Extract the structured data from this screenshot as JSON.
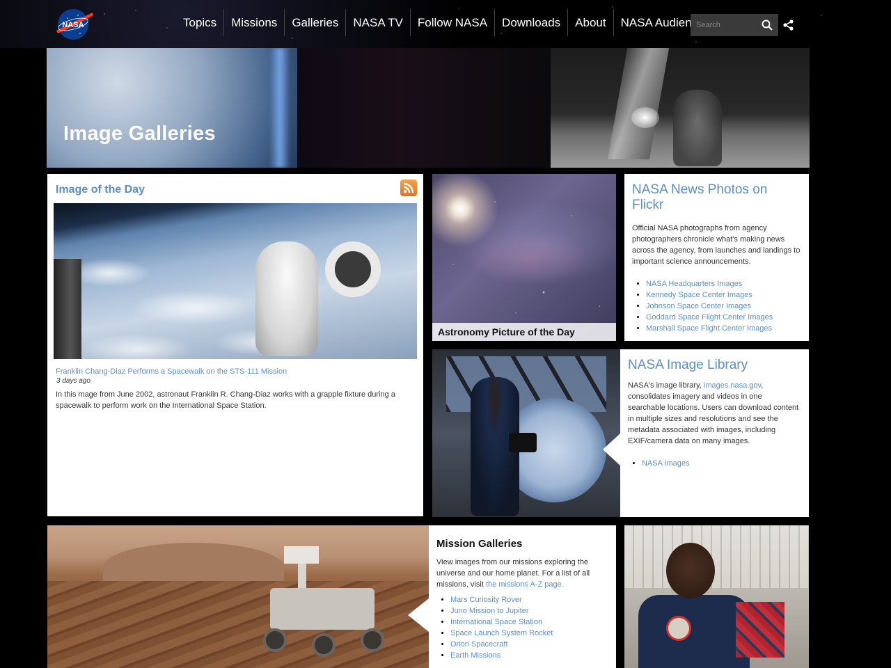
{
  "header": {
    "logo_text": "NASA",
    "nav": [
      "Topics",
      "Missions",
      "Galleries",
      "NASA TV",
      "Follow NASA",
      "Downloads",
      "About",
      "NASA Audiences"
    ],
    "search_placeholder": "Search"
  },
  "hero": {
    "title": "Image Galleries"
  },
  "image_of_the_day": {
    "title": "Image of the Day",
    "caption_link": "Franklin Chang-Diaz Performs a Spacewalk on the STS-111 Mission",
    "date": "3 days ago",
    "description": "In this mage from June 2002, astronaut Franklin R. Chang-Diaz works with a grapple fixture during a spacewalk to perform work on the International Space Station."
  },
  "apod": {
    "label": "Astronomy Picture of the Day"
  },
  "flickr": {
    "title": "NASA News Photos on Flickr",
    "description": "Official NASA photographs from agency photographers chronicle what's making news across the agency, from launches and landings to important science announcements.",
    "links": [
      "NASA Headquarters Images",
      "Kennedy Space Center Images",
      "Johnson Space Center Images",
      "Goddard Space Flight Center Images",
      "Marshall Space Flight Center Images"
    ]
  },
  "library": {
    "title": "NASA Image Library",
    "text_before": "NASA's image library, ",
    "inline_link": "images.nasa.gov",
    "text_after": ", consolidates imagery and videos in one searchable locations. Users can download content in multiple sizes and resolutions and see the metadata associated with images, including EXIF/camera data on many images.",
    "links": [
      "NASA Images"
    ]
  },
  "missions": {
    "title": "Mission Galleries",
    "text_before": "View images from our missions exploring the universe and our home planet. For a list of all missions, visit ",
    "inline_link": "the missions A-Z page.",
    "links": [
      "Mars Curiosity Rover",
      "Juno Mission to Jupiter",
      "International Space Station",
      "Space Launch System Rocket",
      "Orion Spacecraft",
      "Earth Missions"
    ]
  },
  "colors": {
    "link": "#5b8fce",
    "title_blue": "#5a8ec7",
    "rss_orange": "#e8842e",
    "nasa_blue": "#0b3d91",
    "nasa_red": "#fc3d21"
  },
  "icons": [
    "nasa-logo-icon",
    "search-icon",
    "share-icon",
    "rss-icon"
  ]
}
